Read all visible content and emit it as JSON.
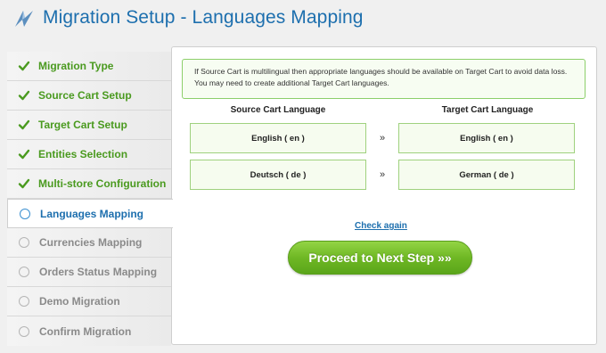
{
  "header": {
    "title": "Migration Setup - Languages Mapping",
    "logo_icon": "migration-logo-icon"
  },
  "sidebar": {
    "steps": [
      {
        "label": "Migration Type",
        "state": "done"
      },
      {
        "label": "Source Cart Setup",
        "state": "done"
      },
      {
        "label": "Target Cart Setup",
        "state": "done"
      },
      {
        "label": "Entities Selection",
        "state": "done"
      },
      {
        "label": "Multi-store Configuration",
        "state": "done"
      },
      {
        "label": "Languages Mapping",
        "state": "active"
      },
      {
        "label": "Currencies Mapping",
        "state": "todo"
      },
      {
        "label": "Orders Status Mapping",
        "state": "todo"
      },
      {
        "label": "Demo Migration",
        "state": "todo"
      },
      {
        "label": "Confirm Migration",
        "state": "todo"
      }
    ]
  },
  "main": {
    "notice_line1": "If Source Cart is multilingual then appropriate languages should be available on Target Cart to avoid data loss.",
    "notice_line2": "You may need to create additional Target Cart languages.",
    "source_header": "Source Cart Language",
    "target_header": "Target Cart Language",
    "mappings": [
      {
        "source": "English ( en )",
        "arrow": "»",
        "target": "English ( en )"
      },
      {
        "source": "Deutsch ( de )",
        "arrow": "»",
        "target": "German ( de )"
      }
    ],
    "check_again": "Check again",
    "proceed_label": "Proceed to Next Step »»"
  },
  "colors": {
    "accent": "#1d6fae",
    "done": "#4a9a1f",
    "todo": "#8a8a8a",
    "button": "#6fb824"
  }
}
